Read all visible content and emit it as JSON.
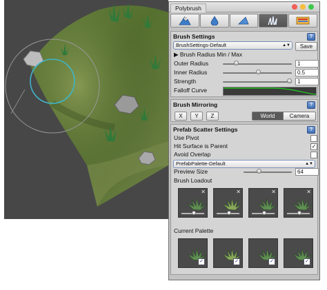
{
  "window": {
    "title": "Polybrush"
  },
  "toolbar": {
    "modes": [
      {
        "name": "raise-lower-mode-button",
        "icon": "mountain-icon"
      },
      {
        "name": "smooth-mode-button",
        "icon": "droplet-icon"
      },
      {
        "name": "texture-paint-mode-button",
        "icon": "triangle-icon"
      },
      {
        "name": "scatter-mode-button",
        "icon": "grass-icon",
        "active": true
      },
      {
        "name": "texture-mode-button",
        "icon": "texture-icon"
      }
    ]
  },
  "brush_settings": {
    "header": "Brush Settings",
    "preset": "BrushSettings-Default",
    "save_label": "Save",
    "radius_foldout": "Brush Radius Min / Max",
    "outer_radius": {
      "label": "Outer Radius",
      "value": "1",
      "level": 0.17
    },
    "inner_radius": {
      "label": "Inner Radius",
      "value": "0.5",
      "level": 0.52
    },
    "strength": {
      "label": "Strength",
      "value": "1",
      "level": 1.0
    },
    "falloff_label": "Falloff Curve"
  },
  "mirroring": {
    "header": "Brush Mirroring",
    "axes": [
      "X",
      "Y",
      "Z"
    ],
    "space_world": "World",
    "space_camera": "Camera",
    "selected_space": "World"
  },
  "scatter": {
    "header": "Prefab Scatter Settings",
    "use_pivot": {
      "label": "Use Pivot",
      "checked": false
    },
    "hit_surface": {
      "label": "Hit Surface is Parent",
      "checked": true
    },
    "avoid_overlap": {
      "label": "Avoid Overlap",
      "checked": false
    },
    "palette": "PrefabPalette-Default",
    "preview_size": {
      "label": "Preview Size",
      "value": "64",
      "level": 0.3
    },
    "loadout_label": "Brush Loadout",
    "current_palette_label": "Current Palette",
    "loadout_count": 4,
    "palette_count": 4
  },
  "colors": {
    "accent": "#3b63a8",
    "curve": "#1fd320",
    "scene_bg": "#474747",
    "grass": "#5f7a38",
    "brush_ring": "#3fb5c9"
  }
}
